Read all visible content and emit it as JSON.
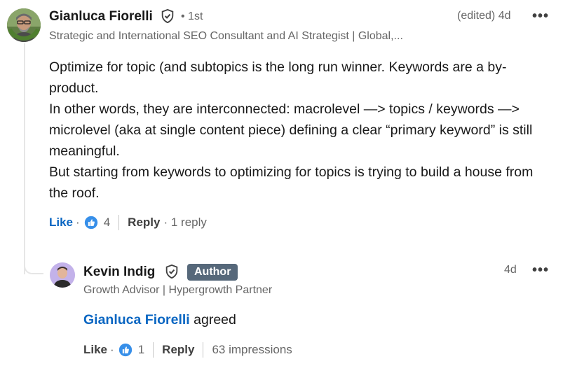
{
  "comment": {
    "author": "Gianluca Fiorelli",
    "degree": "• 1st",
    "headline": "Strategic and International SEO Consultant and AI Strategist | Global,...",
    "edited_time": "(edited) 4d",
    "more_label": "•••",
    "paragraphs": [
      "Optimize for topic (and subtopics is the long run winner. Keywords are a by-product.",
      "In other words, they are interconnected: macrolevel —> topics / keywords —> microlevel (aka at single content piece) defining a clear “primary keyword” is still meaningful.",
      "But starting from keywords to optimizing for topics is trying to build a house from the roof."
    ],
    "actions": {
      "like_label": "Like",
      "dot": "·",
      "reaction_count": "4",
      "reply_label": "Reply",
      "reply_count": "· 1 reply"
    }
  },
  "reply": {
    "author": "Kevin Indig",
    "badge": "Author",
    "headline": "Growth Advisor | Hypergrowth Partner",
    "time": "4d",
    "more_label": "•••",
    "agreed_name": "Gianluca Fiorelli",
    "agreed_text": " agreed",
    "actions": {
      "like_label": "Like",
      "dot": "·",
      "reaction_count": "1",
      "reply_label": "Reply",
      "impressions": "63 impressions"
    }
  },
  "colors": {
    "link_blue": "#0a66c2",
    "secondary_text": "#666666",
    "badge_bg": "#56687a"
  }
}
